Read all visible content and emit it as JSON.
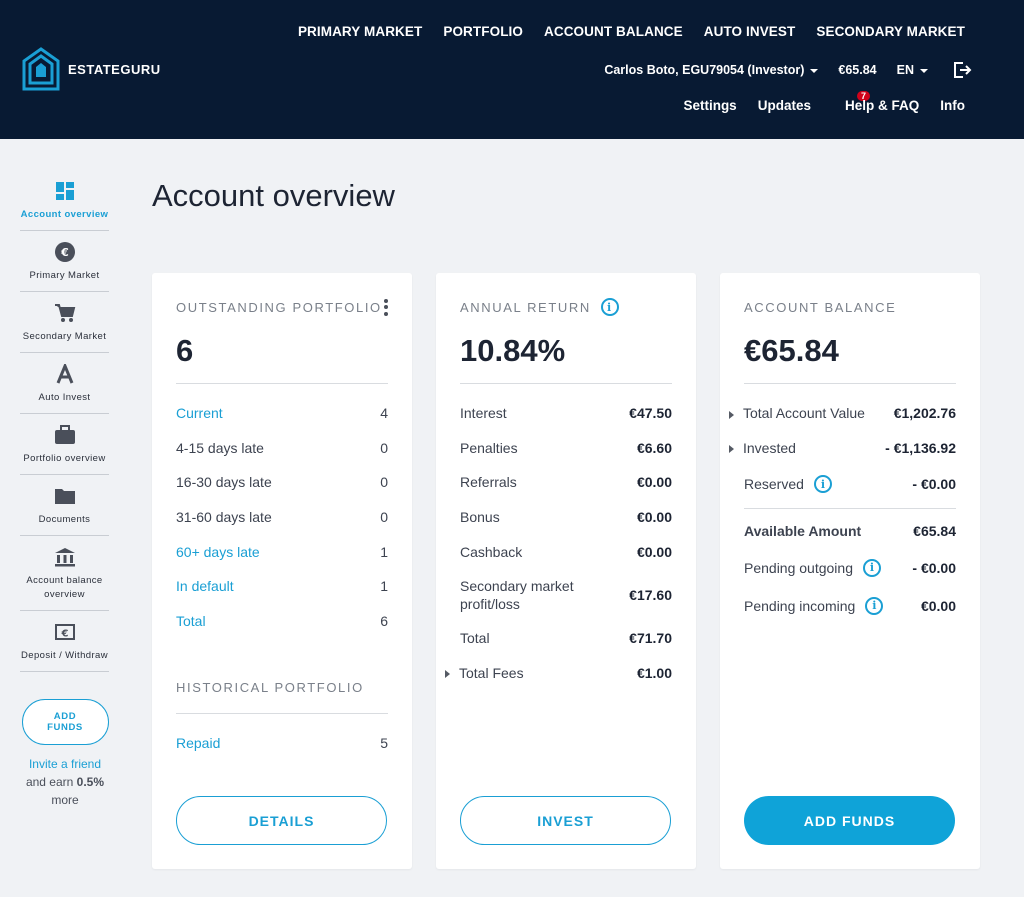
{
  "brand": {
    "name": "ESTATEGURU"
  },
  "nav": {
    "main": [
      "PRIMARY MARKET",
      "PORTFOLIO",
      "ACCOUNT BALANCE",
      "AUTO INVEST",
      "SECONDARY MARKET"
    ],
    "user": "Carlos Boto, EGU79054 (Investor)",
    "balance": "€65.84",
    "language": "EN",
    "links": [
      "Settings",
      "Updates",
      "Help & FAQ",
      "Info"
    ],
    "updates_badge": "7"
  },
  "sidebar": {
    "items": [
      {
        "label": "Account overview",
        "icon": "dashboard-icon"
      },
      {
        "label": "Primary Market",
        "icon": "euro-coin-icon"
      },
      {
        "label": "Secondary Market",
        "icon": "cart-icon"
      },
      {
        "label": "Auto Invest",
        "icon": "letter-a-icon"
      },
      {
        "label": "Portfolio overview",
        "icon": "briefcase-icon"
      },
      {
        "label": "Documents",
        "icon": "folder-icon"
      },
      {
        "label": "Account balance overview",
        "icon": "bank-icon"
      },
      {
        "label": "Deposit / Withdraw",
        "icon": "euro-card-icon"
      }
    ],
    "add_funds": "ADD FUNDS",
    "invite_link": "Invite a friend",
    "invite_text_1": "and earn ",
    "invite_bold": "0.5%",
    "invite_text_2": "more"
  },
  "page": {
    "title": "Account overview"
  },
  "portfolio": {
    "heading": "OUTSTANDING PORTFOLIO",
    "value": "6",
    "rows": [
      {
        "label": "Current",
        "value": "4"
      },
      {
        "label": "4-15 days late",
        "value": "0"
      },
      {
        "label": "16-30 days late",
        "value": "0"
      },
      {
        "label": "31-60 days late",
        "value": "0"
      },
      {
        "label": "60+ days late",
        "value": "1"
      },
      {
        "label": "In default",
        "value": "1"
      },
      {
        "label": "Total",
        "value": "6"
      }
    ],
    "historical_heading": "HISTORICAL PORTFOLIO",
    "historical_rows": [
      {
        "label": "Repaid",
        "value": "5"
      }
    ],
    "button": "DETAILS"
  },
  "annual": {
    "heading": "ANNUAL RETURN",
    "value": "10.84%",
    "rows": [
      {
        "label": "Interest",
        "value": "€47.50"
      },
      {
        "label": "Penalties",
        "value": "€6.60"
      },
      {
        "label": "Referrals",
        "value": "€0.00"
      },
      {
        "label": "Bonus",
        "value": "€0.00"
      },
      {
        "label": "Cashback",
        "value": "€0.00"
      },
      {
        "label": "Secondary market profit/loss",
        "value": "€17.60"
      },
      {
        "label": "Total",
        "value": "€71.70"
      },
      {
        "label": "Total Fees",
        "value": "€1.00"
      }
    ],
    "button": "INVEST"
  },
  "balance": {
    "heading": "ACCOUNT BALANCE",
    "value": "€65.84",
    "rows": [
      {
        "label": "Total Account Value",
        "value": "€1,202.76"
      },
      {
        "label": "Invested",
        "value": "- €1,136.92"
      },
      {
        "label": "Reserved",
        "value": "- €0.00"
      },
      {
        "label": "Available Amount",
        "value": "€65.84"
      },
      {
        "label": "Pending outgoing",
        "value": "- €0.00"
      },
      {
        "label": "Pending incoming",
        "value": "€0.00"
      }
    ],
    "button": "ADD FUNDS"
  },
  "colors": {
    "header": "#081a33",
    "accent": "#1a9fd4",
    "badge": "#d0021b"
  }
}
